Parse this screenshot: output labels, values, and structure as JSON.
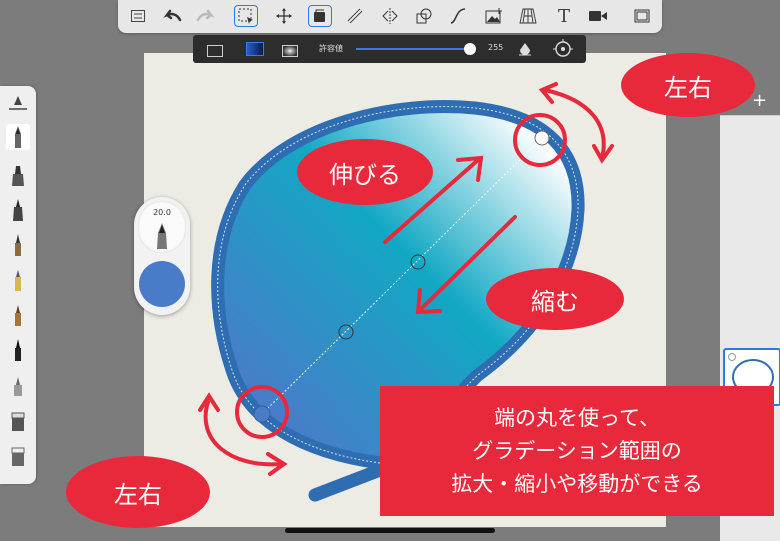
{
  "toolbar": {
    "icons": [
      "list-icon",
      "undo-icon",
      "redo-icon",
      "selection-icon",
      "transform-icon",
      "fill-icon",
      "ruler-icon",
      "symmetry-icon",
      "shapes-icon",
      "curve-icon",
      "image-icon",
      "perspective-icon",
      "text-icon",
      "video-icon",
      "layout-icon"
    ],
    "text_tool_glyph": "T"
  },
  "fill_bar": {
    "threshold_label": "許容値",
    "threshold_value": "255",
    "threshold_fraction": 1.0
  },
  "brush_size": {
    "value": "20.0",
    "color": "#4a7bc9"
  },
  "annotations": {
    "left_right_top": "左右",
    "stretch": "伸びる",
    "shrink": "縮む",
    "left_right_bottom": "左右",
    "info_line1": "端の丸を使って、",
    "info_line2": "グラデーション範囲の",
    "info_line3": "拡大・縮小や移動ができる"
  },
  "layers": {
    "add_label": "+"
  },
  "colors": {
    "accent": "#e8293c",
    "stroke": "#2f6db3",
    "selected": "#2a7be6"
  }
}
